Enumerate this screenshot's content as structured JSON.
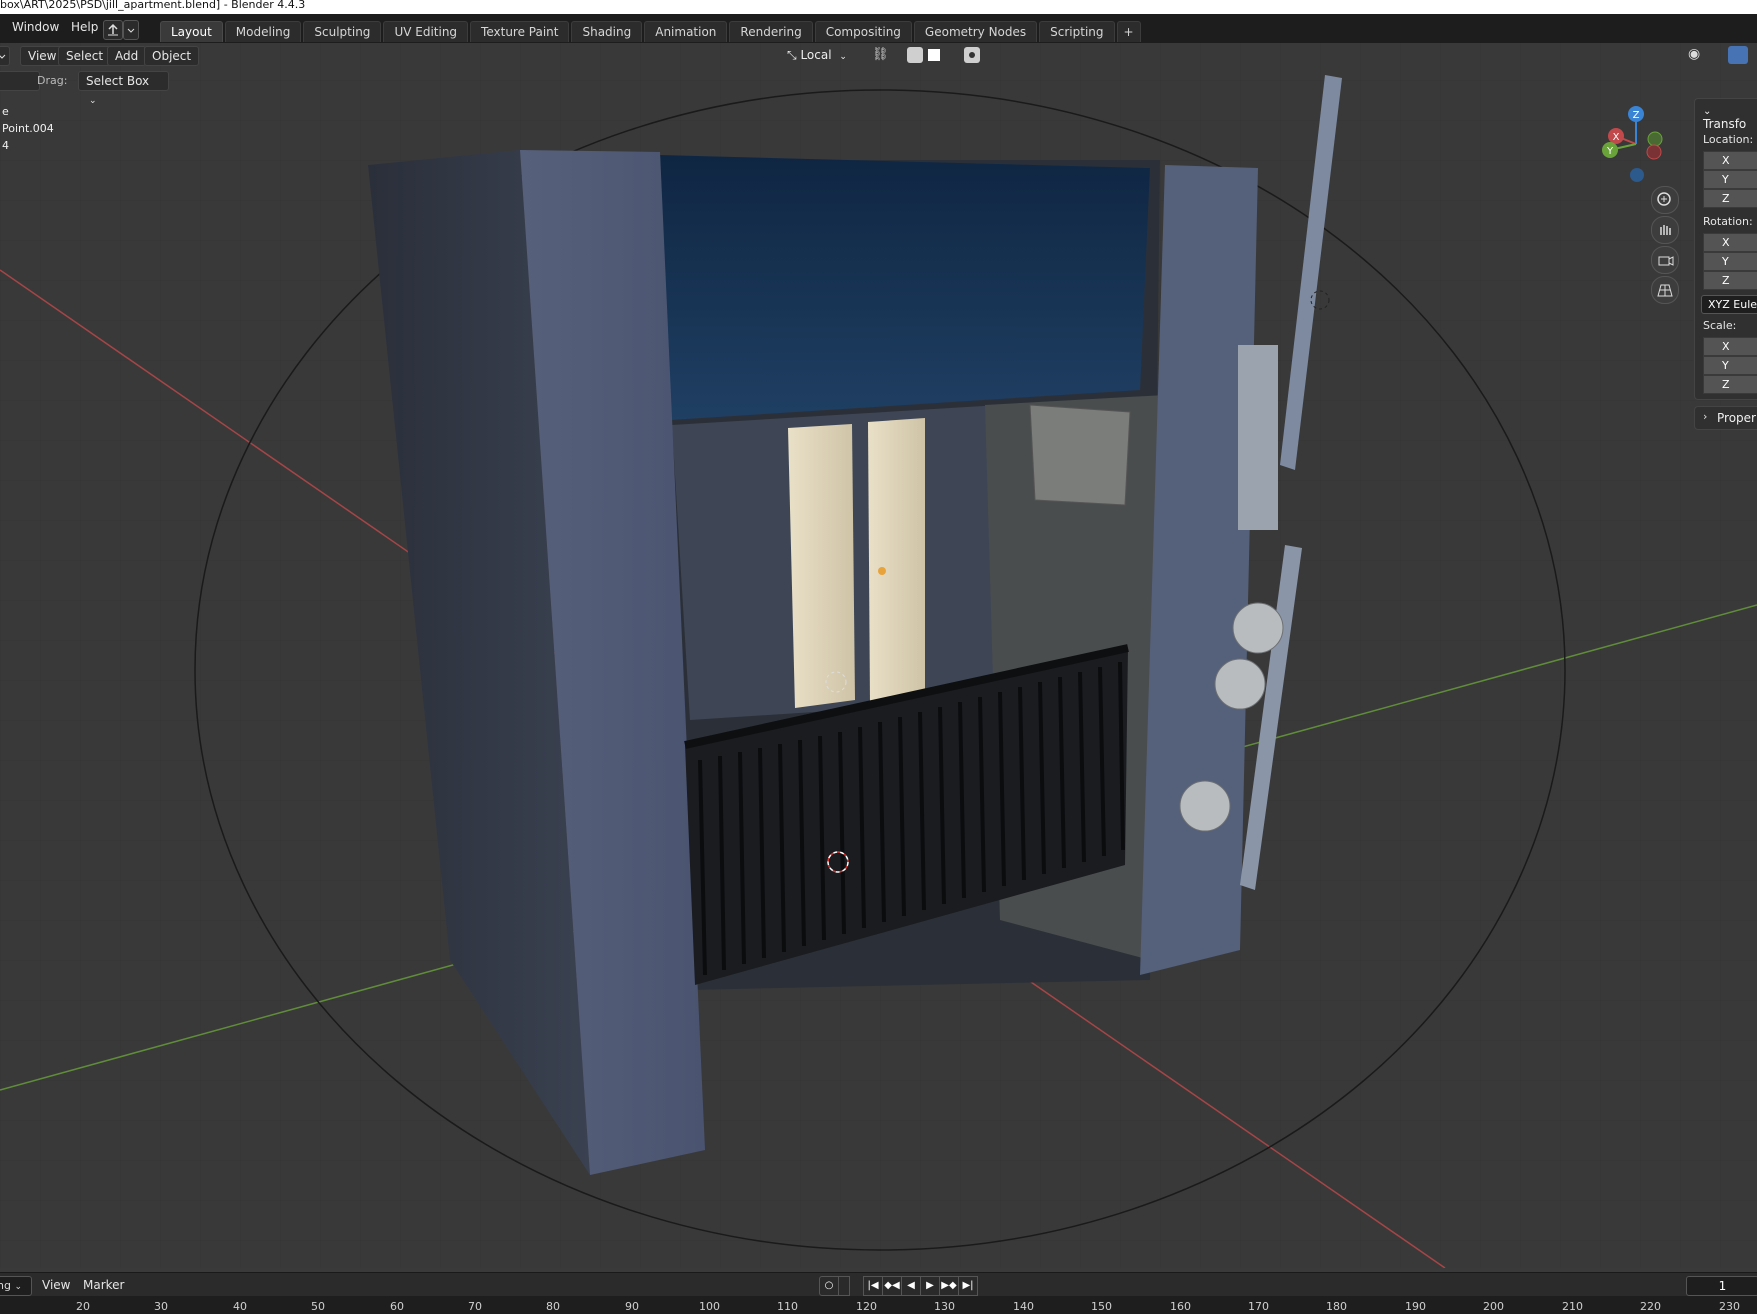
{
  "window": {
    "title": "box\\ART\\2025\\PSD\\jill_apartment.blend] - Blender 4.4.3"
  },
  "topbar": {
    "menu": [
      "Window",
      "Help"
    ],
    "tabs": [
      "Layout",
      "Modeling",
      "Sculpting",
      "UV Editing",
      "Texture Paint",
      "Shading",
      "Animation",
      "Rendering",
      "Compositing",
      "Geometry Nodes",
      "Scripting",
      "+"
    ],
    "active_tab": "Layout"
  },
  "viewport_header": {
    "menus": [
      "View",
      "Select",
      "Add",
      "Object"
    ],
    "transform_orientation": "Local",
    "drag_label": "Drag:",
    "drag_mode": "Select Box"
  },
  "viewport_info": {
    "lines": [
      "e",
      "Point.004",
      "4"
    ]
  },
  "gizmo": {
    "x": "X",
    "y": "Y",
    "z": "Z"
  },
  "npanel": {
    "transform_title": "Transfo",
    "location_label": "Location:",
    "rotation_label": "Rotation:",
    "scale_label": "Scale:",
    "axes": [
      "X",
      "Y",
      "Z"
    ],
    "rotation_mode": "XYZ Eule",
    "properties_title": "Proper"
  },
  "timeline": {
    "mode": "ng",
    "menus": [
      "View",
      "Marker"
    ],
    "current_frame": "1",
    "ruler": [
      "20",
      "30",
      "40",
      "50",
      "60",
      "70",
      "80",
      "90",
      "100",
      "110",
      "120",
      "130",
      "140",
      "150",
      "160",
      "170",
      "180",
      "190",
      "200",
      "210",
      "220",
      "230"
    ]
  },
  "colors": {
    "x_axis": "#c2494b",
    "y_axis": "#6aa33a",
    "z_axis": "#3a84d6",
    "selected": "#e8a43a"
  }
}
